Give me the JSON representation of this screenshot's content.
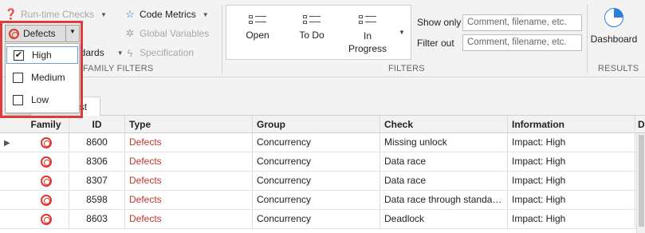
{
  "ribbon": {
    "runtime_checks": "Run-time Checks",
    "code_metrics": "Code Metrics",
    "global_variables": "Global Variables",
    "standards": "ndards",
    "specification": "Specification",
    "family_filters_label": "FAMILY FILTERS",
    "filters_label": "FILTERS",
    "results_label": "RESULTS",
    "filter_buttons": [
      {
        "label": "Open"
      },
      {
        "label": "To Do"
      },
      {
        "label": "In Progress"
      }
    ],
    "show_only_label": "Show only",
    "show_only_placeholder": "Comment, filename, etc.",
    "filter_out_label": "Filter out",
    "filter_out_placeholder": "Comment, filename, etc.",
    "dashboard_label": "Dashboard"
  },
  "tabs": {
    "results_list": "Results List"
  },
  "dropdown": {
    "button_label": "Defects",
    "items": [
      {
        "label": "High",
        "checked": true
      },
      {
        "label": "Medium",
        "checked": false
      },
      {
        "label": "Low",
        "checked": false
      }
    ]
  },
  "table": {
    "headers": [
      "Family",
      "ID",
      "Type",
      "Group",
      "Check",
      "Information",
      "D"
    ],
    "rows": [
      {
        "id": "8600",
        "type": "Defects",
        "group": "Concurrency",
        "check": "Missing unlock",
        "info": "Impact: High",
        "d": "I"
      },
      {
        "id": "8306",
        "type": "Defects",
        "group": "Concurrency",
        "check": "Data race",
        "info": "Impact: High",
        "d": "C"
      },
      {
        "id": "8307",
        "type": "Defects",
        "group": "Concurrency",
        "check": "Data race",
        "info": "Impact: High",
        "d": "C"
      },
      {
        "id": "8598",
        "type": "Defects",
        "group": "Concurrency",
        "check": "Data race through standard library function call",
        "info": "Impact: High",
        "d": "C"
      },
      {
        "id": "8603",
        "type": "Defects",
        "group": "Concurrency",
        "check": "Deadlock",
        "info": "Impact: High",
        "d": "M"
      }
    ]
  },
  "colors": {
    "highlight": "#e03c3c",
    "defect_text": "#c0392b",
    "dashboard_accent": "#2f7fd6"
  }
}
